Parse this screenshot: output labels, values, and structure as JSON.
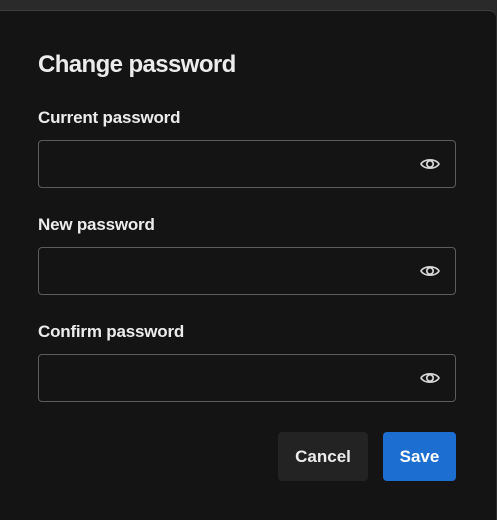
{
  "dialog": {
    "title": "Change password",
    "fields": [
      {
        "label": "Current password",
        "value": "",
        "toggle_icon": "eye-icon"
      },
      {
        "label": "New password",
        "value": "",
        "toggle_icon": "eye-icon"
      },
      {
        "label": "Confirm password",
        "value": "",
        "toggle_icon": "eye-icon"
      }
    ],
    "cancel_label": "Cancel",
    "save_label": "Save"
  },
  "colors": {
    "background": "#141414",
    "text": "#ececec",
    "field_border": "#5c5c5c",
    "cancel_bg": "#232323",
    "save_bg": "#1c6fd0"
  }
}
